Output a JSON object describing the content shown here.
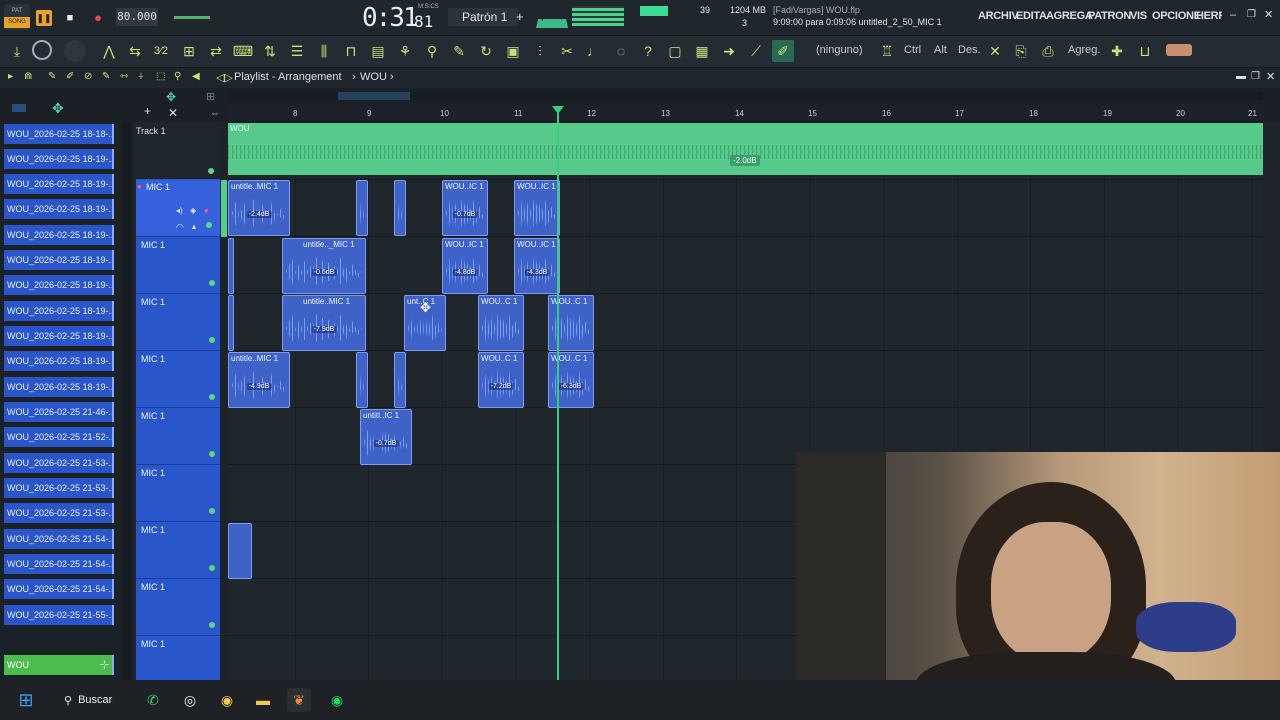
{
  "top": {
    "song_badge": "SONG",
    "pat_badge": "PAT",
    "tempo": "80.000",
    "time": "0:31",
    "time_frac": "81",
    "time_unit": "M:S:CS",
    "pattern": "Patrón 1",
    "cpu": "39",
    "ram": "1204 MB",
    "voices": "3",
    "user_file": "[FadiVargas] WOU.flp",
    "hint": "9:09:00 para 0:09:06 untitled_2_50_MIC 1",
    "menus": [
      "ARCHIV",
      "EDITA",
      "AGREGA",
      "PATRON",
      "VIS",
      "OPCIONE",
      "HERRAMIENTA"
    ]
  },
  "toolbar": {
    "none_label": "(ninguno)",
    "ctrl_label": "Ctrl",
    "alt_label": "Alt",
    "des_label": "Des.",
    "agreg_label": "Agreg."
  },
  "playlist": {
    "title": "Playlist - Arrangement",
    "crumb": "WOU",
    "ruler": [
      "8",
      "9",
      "10",
      "11",
      "12",
      "13",
      "14",
      "15",
      "16",
      "17",
      "18",
      "19",
      "20",
      "21"
    ],
    "track1_label": "Track 1",
    "audio_clip_name": "WOU",
    "audio_clip_db": "-2.0dB"
  },
  "browser": {
    "items": [
      "WOU_2026-02-25 18-18-...",
      "WOU_2026-02-25 18-19-...",
      "WOU_2026-02-25 18-19-...",
      "WOU_2026-02-25 18-19-...",
      "WOU_2026-02-25 18-19-...",
      "WOU_2026-02-25 18-19-...",
      "WOU_2026-02-25 18-19-...",
      "WOU_2026-02-25 18-19-...",
      "WOU_2026-02-25 18-19-...",
      "WOU_2026-02-25 18-19-...",
      "WOU_2026-02-25 18-19-...",
      "WOU_2026-02-25 21-46-...",
      "WOU_2026-02-25 21-52-...",
      "WOU_2026-02-25 21-53-...",
      "WOU_2026-02-25 21-53-...",
      "WOU_2026-02-25 21-53-...",
      "WOU_2026-02-25 21-54-...",
      "WOU_2026-02-25 21-54-...",
      "WOU_2026-02-25 21-54-...",
      "WOU_2026-02-25 21-55-..."
    ],
    "selected": "WOU"
  },
  "tracks": [
    "MIC 1",
    "MIC 1",
    "MIC 1",
    "MIC 1",
    "MIC 1",
    "MIC 1",
    "MIC 1",
    "MIC 1",
    "MIC 1"
  ],
  "clips": {
    "c1": "untitle..MIC 1",
    "c1db": "-2.4dB",
    "c2": "WOU..IC 1",
    "c2db": "-0.7dB",
    "c3": "WOU..IC 1",
    "c4": "untitle.._MIC 1",
    "c4db": "-0.6dB",
    "c5": "WOU..IC 1",
    "c5db": "-4.8dB",
    "c6": "WOU..IC 1",
    "c6db": "-4.3dB",
    "c7": "untitle..MIC 1",
    "c7db": "-7.9dB",
    "c8": "unt..C 1",
    "c9": "WOU..C 1",
    "c10": "WOU..C 1",
    "c11": "untitle..MIC 1",
    "c11db": "-4.9dB",
    "c12": "WOU..C 1",
    "c12db": "-7.2dB",
    "c13": "WOU..C 1",
    "c13db": "-6.3dB",
    "c14": "untitl..IC 1",
    "c14db": "-0.7dB"
  },
  "taskbar": {
    "search": "Buscar"
  },
  "colors": {
    "accent": "#57c98a",
    "clip": "#3f62c9",
    "track": "#2a56cc",
    "playhead": "#33d17a"
  }
}
